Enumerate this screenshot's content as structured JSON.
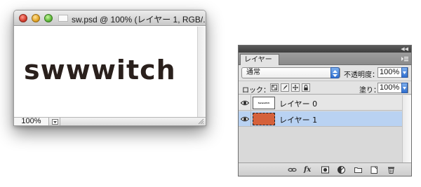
{
  "document_window": {
    "title": "sw.psd @ 100% (レイヤー 1, RGB/...",
    "artwork_text": "swwwitch",
    "zoom": "100%"
  },
  "layers_panel": {
    "tab_label": "レイヤー",
    "blend_mode": "通常",
    "opacity_label": "不透明度：",
    "opacity_value": "100%",
    "lock_label": "ロック：",
    "fill_label": "塗り：",
    "fill_value": "100%",
    "layers": [
      {
        "name": "レイヤー 0",
        "thumbnail_text": "Swwwitch",
        "selected": false
      },
      {
        "name": "レイヤー 1",
        "thumbnail_color": "#d5613b",
        "selected": true
      }
    ],
    "footer_icons": [
      "link-layers-icon",
      "fx-icon",
      "add-mask-icon",
      "adjustment-layer-icon",
      "new-group-icon",
      "new-layer-icon",
      "trash-icon"
    ]
  },
  "colors": {
    "artwork": "#2a201c",
    "layer1_fill": "#d5613b",
    "selection": "#b9d2f2",
    "accent_blue": "#2f6fd1"
  }
}
